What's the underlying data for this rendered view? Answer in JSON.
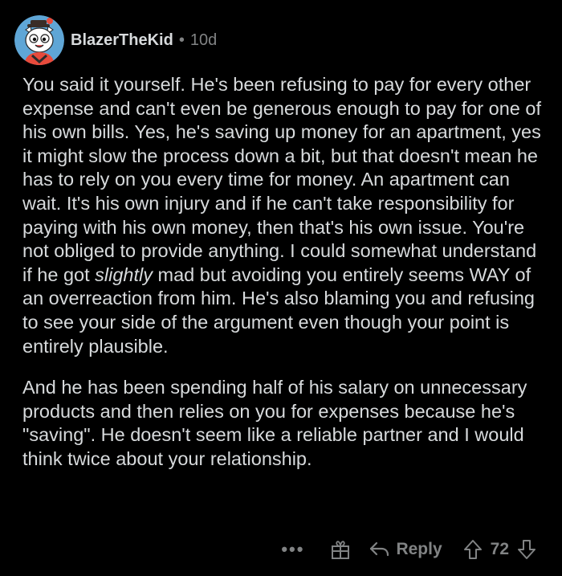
{
  "comment": {
    "username": "BlazerTheKid",
    "separator": "•",
    "age": "10d",
    "paragraph1": [
      {
        "t": "You said it yourself. He's been refusing to pay for every other expense and can't even be generous enough to pay for one of his own bills. Yes, he's saving up money for an apartment, yes it might slow the process down a bit, but that doesn't mean he has to rely on you every time for money. An apartment can wait. It's his own injury and if he can't take responsibility for paying with his own money, then that's his own issue. You're not obliged to provide anything. I could somewhat understand if he got "
      },
      {
        "t": "slightly",
        "italic": true
      },
      {
        "t": " mad but avoiding you entirely seems WAY of an overreaction from him. He's also blaming you and refusing to see your side of the argument even though your point is entirely plausible."
      }
    ],
    "paragraph2": "And he has been spending half of his salary on unnecessary products and then relies on you for expenses because he's \"saving\". He doesn't seem like a reliable partner and I would think twice about your relationship."
  },
  "actions": {
    "more_label": "•••",
    "reply_label": "Reply",
    "score": "72"
  },
  "icons": {
    "more": "more-dots-icon",
    "award": "gift-award-icon",
    "reply": "reply-arrow-icon",
    "upvote": "upvote-arrow-icon",
    "downvote": "downvote-arrow-icon"
  },
  "colors": {
    "background": "#000000",
    "text": "#d7dadc",
    "muted": "#818384",
    "avatar_bg": "#5fa6d6"
  }
}
